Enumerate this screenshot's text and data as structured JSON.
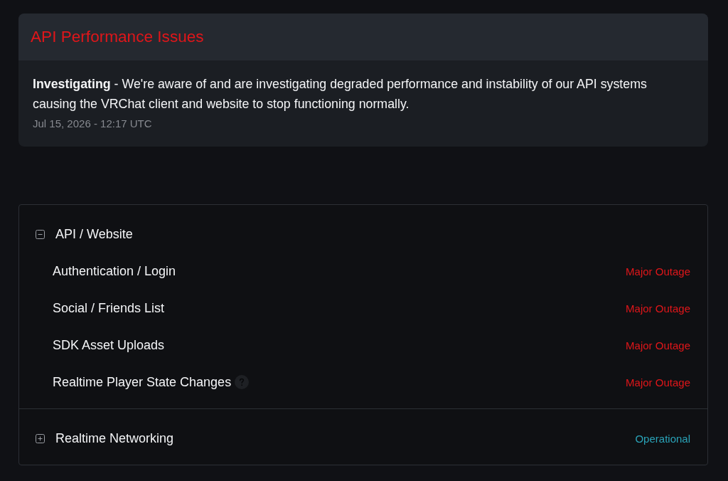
{
  "incident": {
    "title": "API Performance Issues",
    "update": {
      "message": "**Investigating** - We're aware of and are investigating degraded performance and instability of our API systems causing the VRChat client and website to stop functioning normally.",
      "timestamp": "Jul 15, 2026 - 12:17 UTC"
    }
  },
  "components": [
    {
      "name": "API / Website",
      "expanded": true,
      "children": [
        {
          "name": "Authentication / Login",
          "help": false,
          "status": "Major Outage",
          "color": "#e0161a"
        },
        {
          "name": "Social / Friends List",
          "help": false,
          "status": "Major Outage",
          "color": "#e0161a"
        },
        {
          "name": "SDK Asset Uploads",
          "help": false,
          "status": "Major Outage",
          "color": "#e0161a"
        },
        {
          "name": "Realtime Player State Changes",
          "help": true,
          "status": "Major Outage",
          "color": "#e0161a"
        }
      ]
    },
    {
      "name": "Realtime Networking",
      "expanded": false,
      "status": "Operational",
      "color": "#2aa3b8"
    }
  ]
}
